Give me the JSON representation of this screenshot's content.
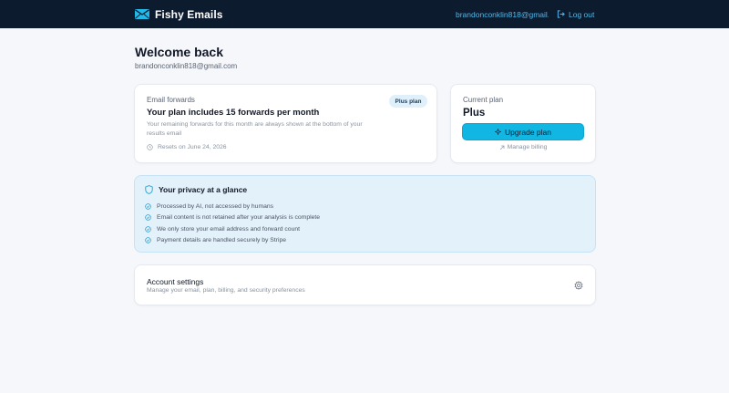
{
  "header": {
    "brand_name": "Fishy Emails",
    "user_email": "brandonconklin818@gmail....",
    "logout_label": "Log out"
  },
  "welcome": {
    "title": "Welcome back",
    "email": "brandonconklin818@gmail.com"
  },
  "forwards_card": {
    "label": "Email forwards",
    "title": "Your plan includes 15 forwards per month",
    "description": "Your remaining forwards for this month are always shown at the bottom of your results email",
    "reset_text": "Resets on June 24, 2026",
    "badge": "Plus plan"
  },
  "plan_card": {
    "label": "Current plan",
    "plan_name": "Plus",
    "upgrade_label": "Upgrade plan",
    "manage_label": "Manage billing"
  },
  "privacy": {
    "title": "Your privacy at a glance",
    "items": [
      "Processed by AI, not accessed by humans",
      "Email content is not retained after your analysis is complete",
      "We only store your email address and forward count",
      "Payment details are handled securely by Stripe"
    ]
  },
  "account_settings": {
    "title": "Account settings",
    "description": "Manage your email, plan, billing, and security preferences"
  },
  "colors": {
    "header_bg": "#0c1c2e",
    "accent": "#12b6e2",
    "link": "#4fb8ec",
    "privacy_bg": "#e3f1fb",
    "page_bg": "#f5f7fa"
  },
  "icons": [
    "envelope-logo-icon",
    "logout-icon",
    "clock-icon",
    "sparkle-icon",
    "arrow-up-right-icon",
    "shield-icon",
    "check-circle-icon",
    "gear-icon"
  ]
}
